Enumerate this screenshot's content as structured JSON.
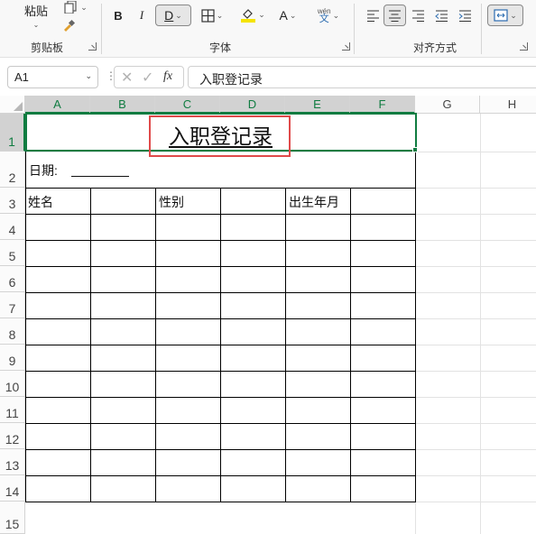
{
  "ribbon": {
    "paste_label": "粘贴",
    "clipboard_group": "剪贴板",
    "font_group": "字体",
    "alignment_group": "对齐方式",
    "bold": "B",
    "italic": "I",
    "underline": "D",
    "font_color_letter": "A",
    "phonetic_top": "wén",
    "phonetic_bottom": "文"
  },
  "formula_bar": {
    "name_box": "A1",
    "formula_value": "入职登记录",
    "fx_label": "fx"
  },
  "sheet": {
    "columns": [
      "A",
      "B",
      "C",
      "D",
      "E",
      "F",
      "G",
      "H"
    ],
    "rows": [
      "1",
      "2",
      "3",
      "4",
      "5",
      "6",
      "7",
      "8",
      "9",
      "10",
      "11",
      "12",
      "13",
      "14",
      "15"
    ],
    "title": "入职登记录",
    "date_label": "日期:",
    "header_name": "姓名",
    "header_gender": "性别",
    "header_birth": "出生年月"
  },
  "colors": {
    "selection": "#107c41",
    "highlight_box": "#e04a4a",
    "highlight_yellow": "#f5e400"
  }
}
